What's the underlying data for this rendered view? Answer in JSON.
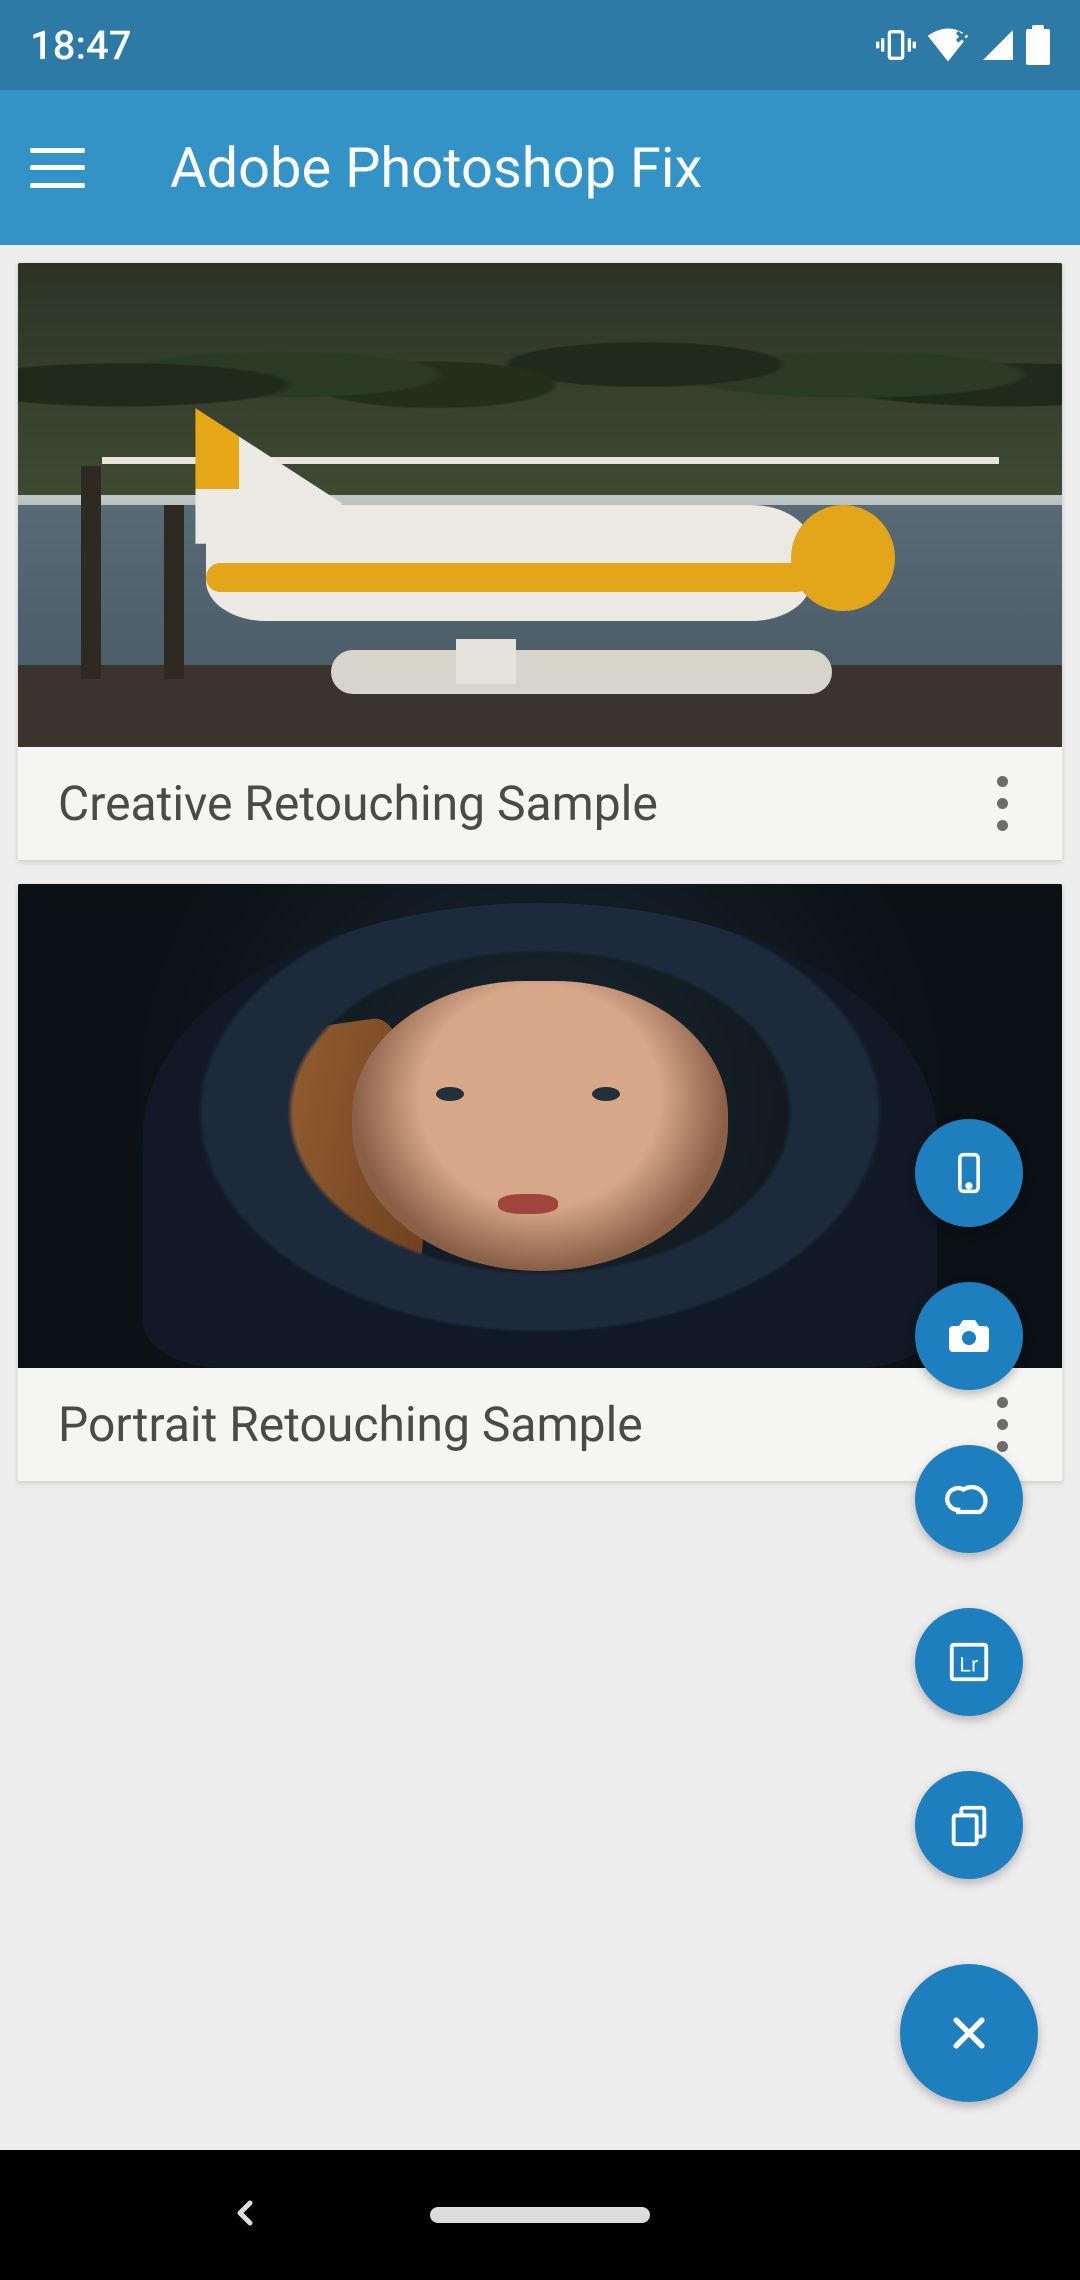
{
  "status": {
    "time": "18:47"
  },
  "appbar": {
    "title": "Adobe Photoshop Fix"
  },
  "projects": [
    {
      "title": "Creative Retouching Sample"
    },
    {
      "title": "Portrait Retouching Sample"
    }
  ],
  "fab": {
    "phone": "phone-icon",
    "camera": "camera-icon",
    "cloud": "creative-cloud-icon",
    "lightroom": "lightroom-icon",
    "files": "files-icon",
    "close": "close-icon"
  }
}
